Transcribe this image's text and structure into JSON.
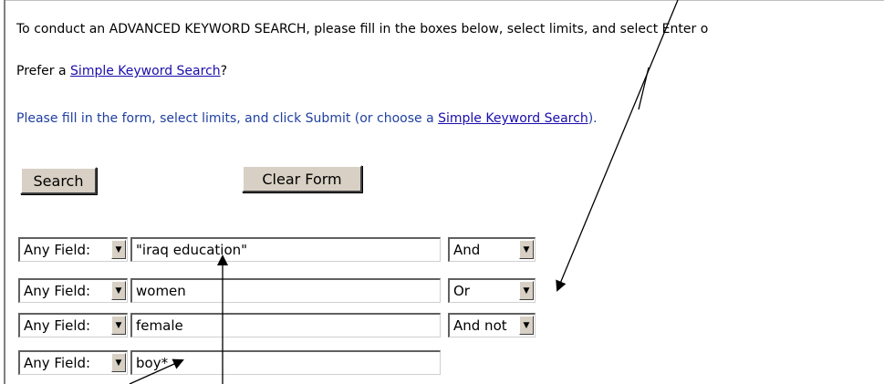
{
  "intro_text": "To conduct an ADVANCED KEYWORD SEARCH, please fill in the boxes below, select limits, and select Enter o",
  "prefer": {
    "prefix": "Prefer a ",
    "link": "Simple Keyword Search",
    "suffix": "?"
  },
  "please": {
    "prefix": "Please fill in the form, select limits, and click Submit (or choose a ",
    "link": "Simple Keyword Search",
    "suffix": ")."
  },
  "buttons": {
    "search": "Search",
    "clear": "Clear Form"
  },
  "rows": [
    {
      "field": "Any Field:",
      "term": "\"iraq education\"",
      "bool": "And"
    },
    {
      "field": "Any Field:",
      "term": "women",
      "bool": "Or"
    },
    {
      "field": "Any Field:",
      "term": "female",
      "bool": "And not"
    },
    {
      "field": "Any Field:",
      "term": "boy*"
    }
  ],
  "icons": {
    "dropdown": "dropdown-arrow-icon"
  },
  "colors": {
    "link": "#1a0dab",
    "instruction_text": "#1f3fa0",
    "button_face": "#d8d0c4"
  }
}
